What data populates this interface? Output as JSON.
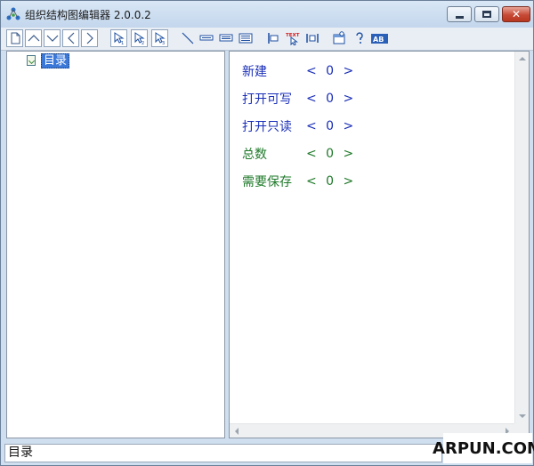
{
  "window": {
    "title": "组织结构图编辑器 2.0.0.2"
  },
  "toolbar": {
    "icons": [
      "new-document-icon",
      "move-up-icon",
      "move-down-icon",
      "move-left-icon",
      "move-right-icon",
      "select-1-icon",
      "select-2-icon",
      "select-3-icon",
      "line-icon",
      "layout-1-icon",
      "layout-2-icon",
      "layout-3-icon",
      "align-left-icon",
      "text-select-icon",
      "distribute-icon",
      "properties-icon",
      "help-icon",
      "ab-text-icon"
    ],
    "text_button_label": "TEXT",
    "ab_button_label": "AB"
  },
  "tree": {
    "root_label": "目录"
  },
  "info": [
    {
      "label": "新建",
      "value": "< 0 >",
      "color": "#1a2fb8"
    },
    {
      "label": "打开可写",
      "value": "< 0 >",
      "color": "#1a2fb8"
    },
    {
      "label": "打开只读",
      "value": "< 0 >",
      "color": "#1a2fb8"
    },
    {
      "label": "总数",
      "value": "< 0 >",
      "color": "#1f7a2a"
    },
    {
      "label": "需要保存",
      "value": "< 0 >",
      "color": "#1f7a2a"
    }
  ],
  "status": {
    "text": "目录"
  },
  "watermark": {
    "text": "ARPUN.COM"
  }
}
